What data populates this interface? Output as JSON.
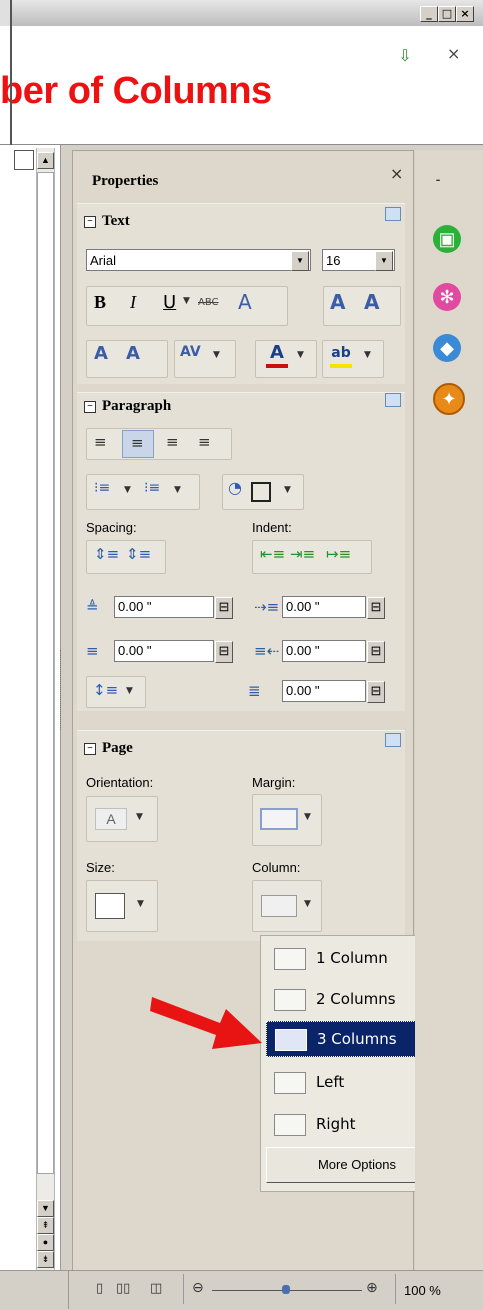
{
  "window": {
    "min_label": "_",
    "max_label": "□",
    "close_label": "×",
    "download_icon": "download-icon",
    "close_doc": "×"
  },
  "document": {
    "title_fragment": "ber of Columns"
  },
  "sidebar": {
    "title": "Properties",
    "close": "×",
    "text_section": {
      "heading": "Text",
      "font_name": "Arial",
      "font_size": "16"
    },
    "paragraph_section": {
      "heading": "Paragraph",
      "spacing_label": "Spacing:",
      "indent_label": "Indent:",
      "above_spacing": "0.00 \"",
      "below_spacing": "0.00 \"",
      "before_indent": "0.00 \"",
      "after_indent": "0.00 \"",
      "first_line_indent": "0.00 \""
    },
    "page_section": {
      "heading": "Page",
      "orientation_label": "Orientation:",
      "margin_label": "Margin:",
      "size_label": "Size:",
      "column_label": "Column:"
    }
  },
  "column_menu": {
    "items": [
      {
        "label": "1 Column"
      },
      {
        "label": "2 Columns"
      },
      {
        "label": "3 Columns",
        "selected": true
      },
      {
        "label": "Left"
      },
      {
        "label": "Right"
      }
    ],
    "more_options": "More Options"
  },
  "statusbar": {
    "zoom": "100 %"
  },
  "colors": {
    "accent_red": "#ee1111",
    "selection": "#0a246a",
    "panel": "#ddd8cb"
  }
}
